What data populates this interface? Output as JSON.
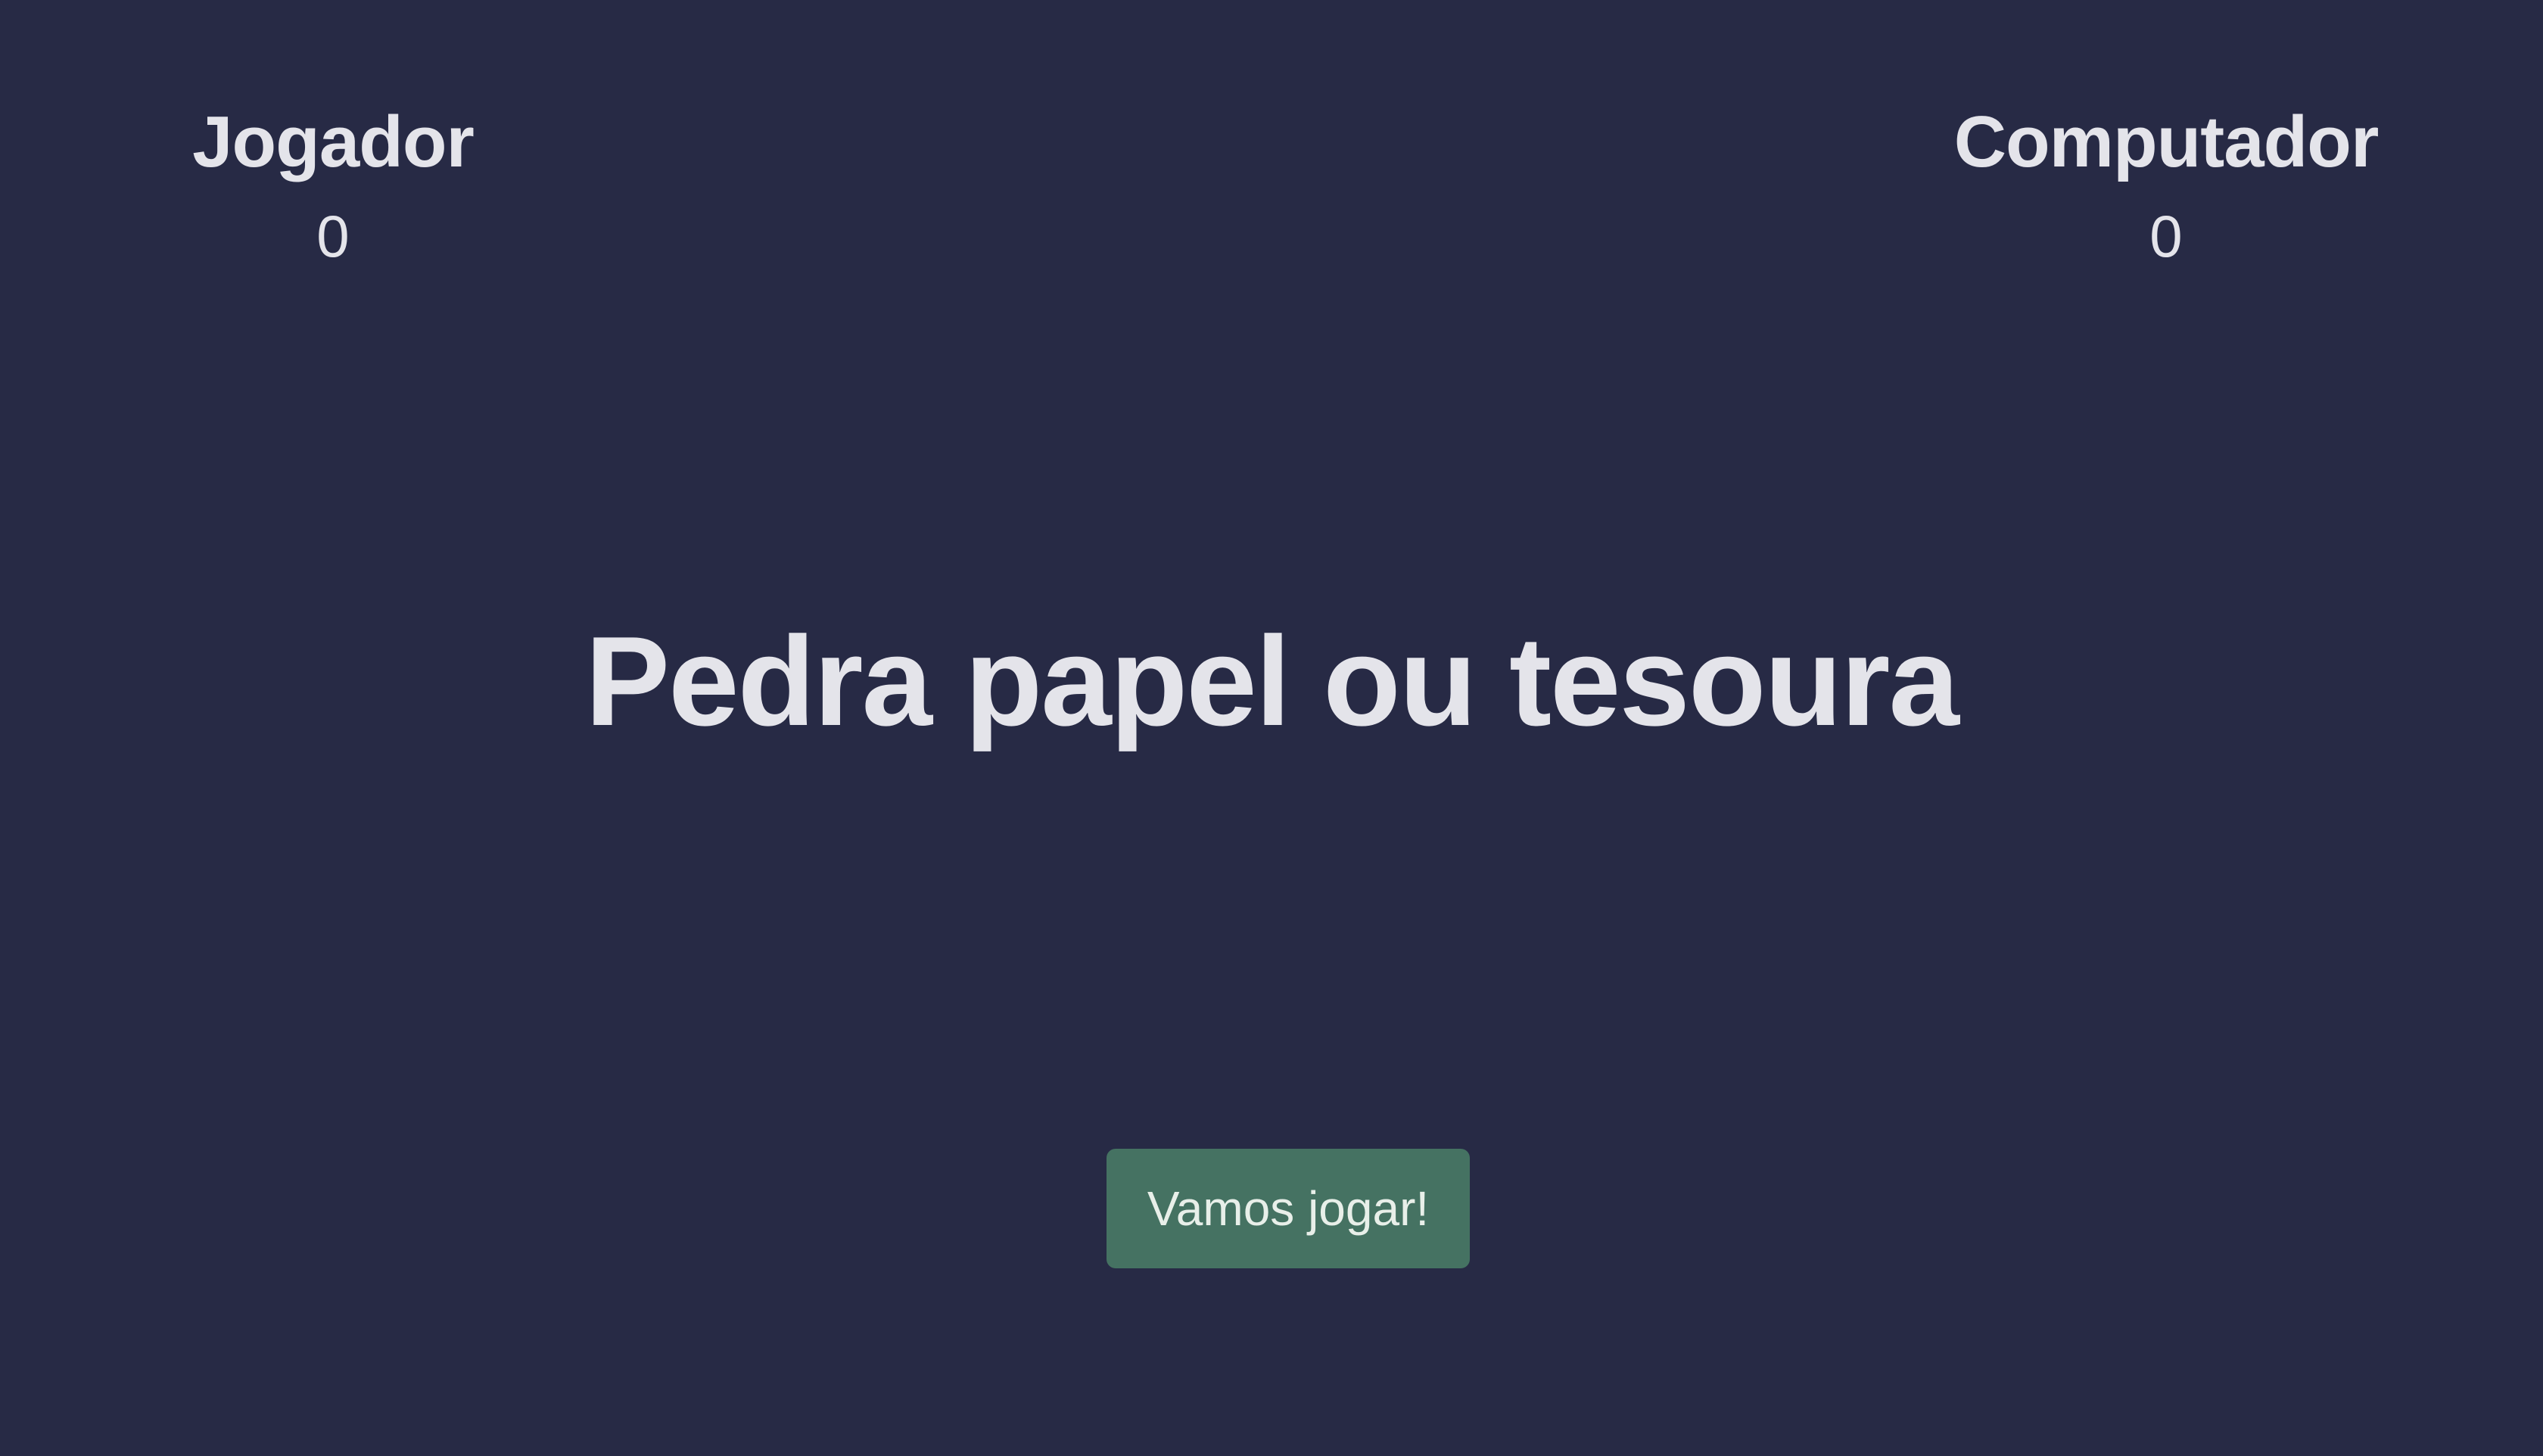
{
  "scoreboard": {
    "player": {
      "label": "Jogador",
      "score": "0"
    },
    "computer": {
      "label": "Computador",
      "score": "0"
    }
  },
  "main": {
    "title": "Pedra papel ou tesoura",
    "play_button_label": "Vamos jogar!"
  },
  "colors": {
    "background": "#272a45",
    "text": "#e4e4ea",
    "button": "#457262"
  }
}
